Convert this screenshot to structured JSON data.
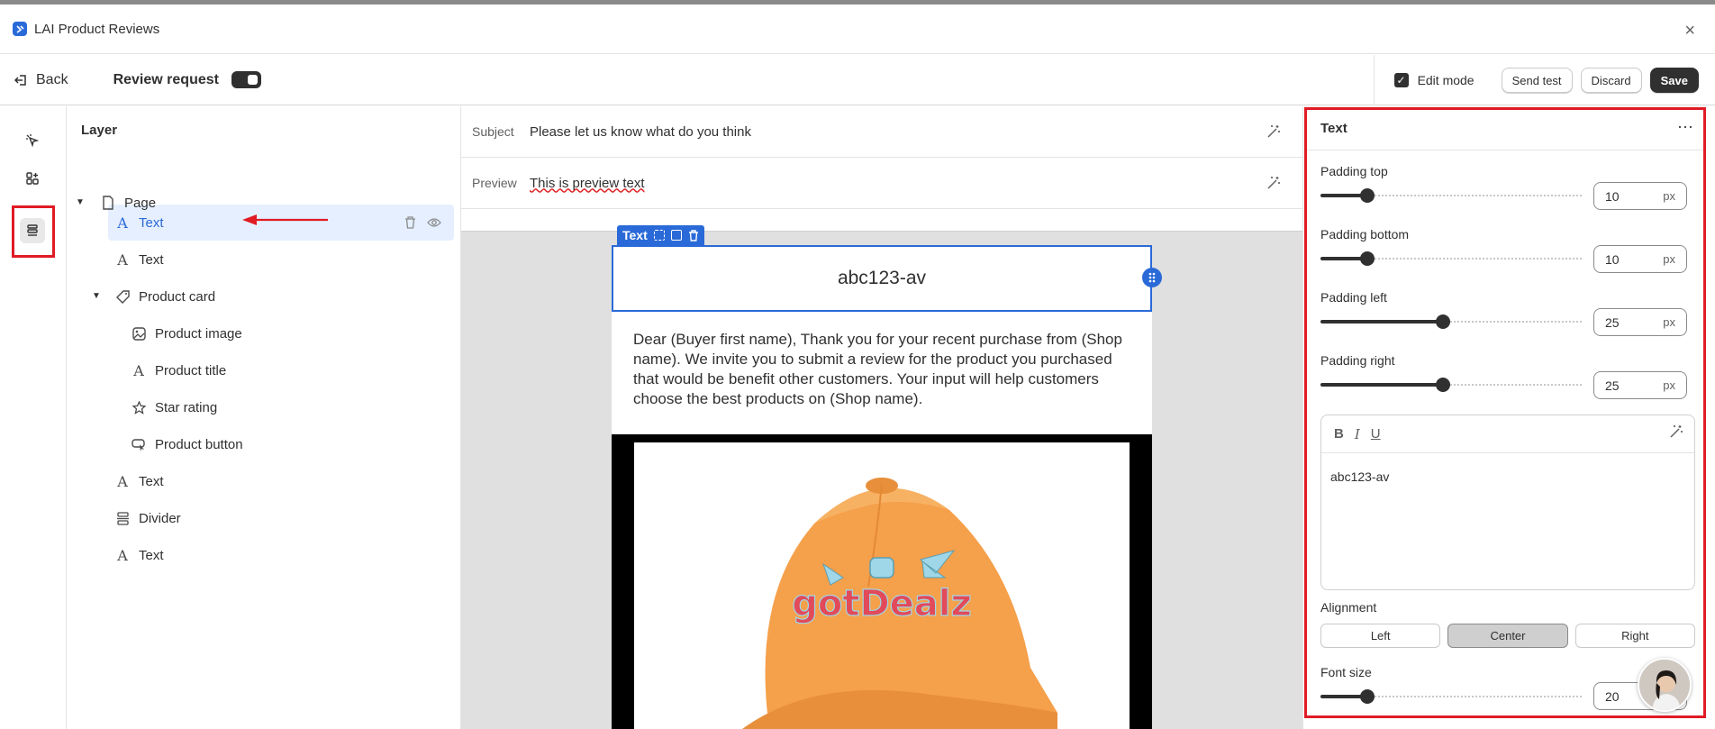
{
  "app": {
    "title": "LAI Product Reviews",
    "close_glyph": "×"
  },
  "toolbar": {
    "back_label": "Back",
    "review_request_label": "Review request",
    "edit_mode_label": "Edit mode",
    "send_test_label": "Send test",
    "discard_label": "Discard",
    "save_label": "Save"
  },
  "rail": {
    "items": [
      "cursor-select-icon",
      "add-block-icon",
      "layers-icon"
    ],
    "active": "layers-icon"
  },
  "layers": {
    "title": "Layer",
    "items": [
      {
        "label": "Page",
        "icon": "page-icon"
      },
      {
        "label": "Text",
        "icon": "text-icon",
        "selected": true
      },
      {
        "label": "Text",
        "icon": "text-icon"
      },
      {
        "label": "Product card",
        "icon": "tag-icon"
      },
      {
        "label": "Product image",
        "icon": "image-icon"
      },
      {
        "label": "Product title",
        "icon": "text-icon"
      },
      {
        "label": "Star rating",
        "icon": "star-icon"
      },
      {
        "label": "Product button",
        "icon": "button-icon"
      },
      {
        "label": "Text",
        "icon": "text-icon"
      },
      {
        "label": "Divider",
        "icon": "divider-icon"
      },
      {
        "label": "Text",
        "icon": "text-icon"
      }
    ]
  },
  "email": {
    "subject_label": "Subject",
    "subject_value": "Please let us know what do you think",
    "preview_label": "Preview",
    "preview_value": "This is preview text",
    "selected_tag": "Text",
    "heading_text": "abc123-av",
    "body_text": "Dear (Buyer first name), Thank you for your recent purchase from (Shop name). We invite you to submit a review for the product you purchased that would be benefit other customers. Your input will help customers choose the best products on (Shop name).",
    "image_logo": "gotDealz"
  },
  "panel": {
    "title": "Text",
    "more_glyph": "···",
    "padding_top": {
      "label": "Padding top",
      "value": "10",
      "unit": "px",
      "level": 0.18
    },
    "padding_bottom": {
      "label": "Padding bottom",
      "value": "10",
      "unit": "px",
      "level": 0.18
    },
    "padding_left": {
      "label": "Padding left",
      "value": "25",
      "unit": "px",
      "level": 0.47
    },
    "padding_right": {
      "label": "Padding right",
      "value": "25",
      "unit": "px",
      "level": 0.47
    },
    "editor": {
      "bold": "B",
      "italic": "I",
      "underline": "U",
      "content": "abc123-av"
    },
    "alignment": {
      "label": "Alignment",
      "options": [
        "Left",
        "Center",
        "Right"
      ],
      "selected": "Center"
    },
    "font_size": {
      "label": "Font size",
      "value": "20",
      "level": 0.18
    }
  },
  "colors": {
    "accent": "#2a6ad8",
    "highlight": "#e01b24",
    "dark": "#303030",
    "hat": "#f5a04a"
  }
}
